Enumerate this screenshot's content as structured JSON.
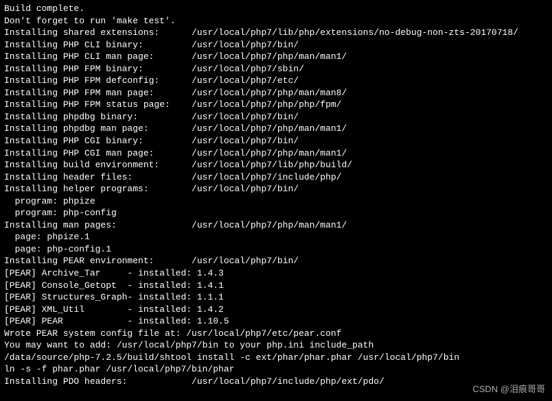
{
  "header": [
    "Build complete.",
    "Don't forget to run 'make test'.",
    ""
  ],
  "install_lines": [
    {
      "label": "Installing shared extensions:",
      "path": "/usr/local/php7/lib/php/extensions/no-debug-non-zts-20170718/"
    },
    {
      "label": "Installing PHP CLI binary:",
      "path": "/usr/local/php7/bin/"
    },
    {
      "label": "Installing PHP CLI man page:",
      "path": "/usr/local/php7/php/man/man1/"
    },
    {
      "label": "Installing PHP FPM binary:",
      "path": "/usr/local/php7/sbin/"
    },
    {
      "label": "Installing PHP FPM defconfig:",
      "path": "/usr/local/php7/etc/"
    },
    {
      "label": "Installing PHP FPM man page:",
      "path": "/usr/local/php7/php/man/man8/"
    },
    {
      "label": "Installing PHP FPM status page:",
      "path": "/usr/local/php7/php/php/fpm/"
    },
    {
      "label": "Installing phpdbg binary:",
      "path": "/usr/local/php7/bin/"
    },
    {
      "label": "Installing phpdbg man page:",
      "path": "/usr/local/php7/php/man/man1/"
    },
    {
      "label": "Installing PHP CGI binary:",
      "path": "/usr/local/php7/bin/"
    },
    {
      "label": "Installing PHP CGI man page:",
      "path": "/usr/local/php7/php/man/man1/"
    },
    {
      "label": "Installing build environment:",
      "path": "/usr/local/php7/lib/php/build/"
    },
    {
      "label": "Installing header files:",
      "path": "/usr/local/php7/include/php/"
    },
    {
      "label": "Installing helper programs:",
      "path": "/usr/local/php7/bin/"
    }
  ],
  "helper_programs": [
    "  program: phpize",
    "  program: php-config"
  ],
  "man_line": {
    "label": "Installing man pages:",
    "path": "/usr/local/php7/php/man/man1/"
  },
  "man_pages": [
    "  page: phpize.1",
    "  page: php-config.1"
  ],
  "pear_env": {
    "label": "Installing PEAR environment:",
    "path": "/usr/local/php7/bin/"
  },
  "pear_pkgs": [
    {
      "name": "[PEAR] Archive_Tar",
      "version": "1.4.3"
    },
    {
      "name": "[PEAR] Console_Getopt",
      "version": "1.4.1"
    },
    {
      "name": "[PEAR] Structures_Graph",
      "version": "1.1.1"
    },
    {
      "name": "[PEAR] XML_Util",
      "version": "1.4.2"
    },
    {
      "name": "[PEAR] PEAR",
      "version": "1.10.5"
    }
  ],
  "footer": [
    "Wrote PEAR system config file at: /usr/local/php7/etc/pear.conf",
    "You may want to add: /usr/local/php7/bin to your php.ini include_path",
    "/data/source/php-7.2.5/build/shtool install -c ext/phar/phar.phar /usr/local/php7/bin",
    "ln -s -f phar.phar /usr/local/php7/bin/phar"
  ],
  "pdo_line": {
    "label": "Installing PDO headers:",
    "path": "/usr/local/php7/include/php/ext/pdo/"
  },
  "watermark": "CSDN @泪痕哥哥",
  "col_path": 35,
  "pear_name_w": 23,
  "pear_inst": "- installed: "
}
